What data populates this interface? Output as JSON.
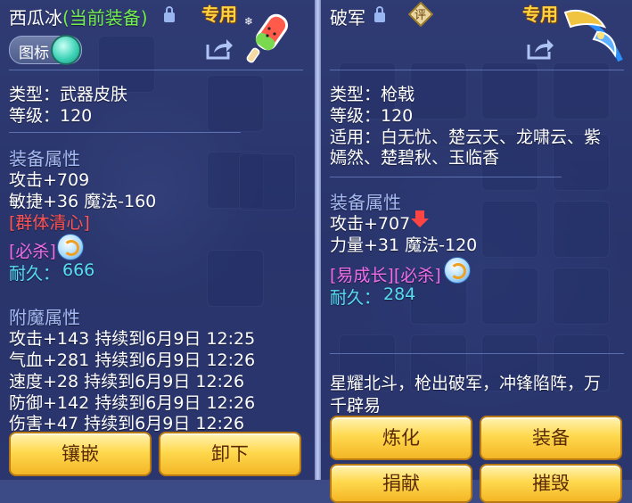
{
  "left": {
    "name": "西瓜冰",
    "equipped_tag": "(当前装备)",
    "exclusive_badge": "专用",
    "icon_chip_label": "图标",
    "info": [
      "类型：武器皮肤",
      "等级：120"
    ],
    "equip_attr_title": "装备属性",
    "attrs": [
      "攻击+709",
      "敏捷+36 魔法-160"
    ],
    "special_red": "[群体清心]",
    "special_pink": "[必杀]",
    "durability_label": "耐久：",
    "durability_value": "666",
    "enchant_title": "附魔属性",
    "enchant": [
      "攻击+143 持续到6月9日 12:25",
      "气血+281 持续到6月9日 12:26",
      "速度+28 持续到6月9日 12:26",
      "防御+142 持续到6月9日 12:26",
      "伤害+47 持续到6月9日 12:26"
    ],
    "btn_inlay": "镶嵌",
    "btn_unequip": "卸下"
  },
  "right": {
    "name": "破军",
    "rating_icon_text": "评",
    "exclusive_badge": "专用",
    "info": [
      "类型：枪戟",
      "等级：120",
      "适用：白无忧、楚云天、龙啸云、紫",
      "嫣然、楚碧秋、玉临香"
    ],
    "equip_attr_title": "装备属性",
    "attrs": [
      "攻击+707",
      "力量+31 魔法-120"
    ],
    "special_pink": "[易成长][必杀]",
    "durability_label": "耐久：",
    "durability_value": "284",
    "desc": [
      "星耀北斗，枪出破军，冲锋陷阵，万",
      "千辟易"
    ],
    "btn_refine": "炼化",
    "btn_equip": "装备",
    "btn_partial_1": "捐献",
    "btn_partial_2": "摧毁"
  },
  "colors": {
    "section": "#a4b9f2",
    "cyan": "#56dff3",
    "red": "#ff5454",
    "pink": "#f06ce8",
    "green": "#72ee4e",
    "badge": "#ffd23f"
  }
}
